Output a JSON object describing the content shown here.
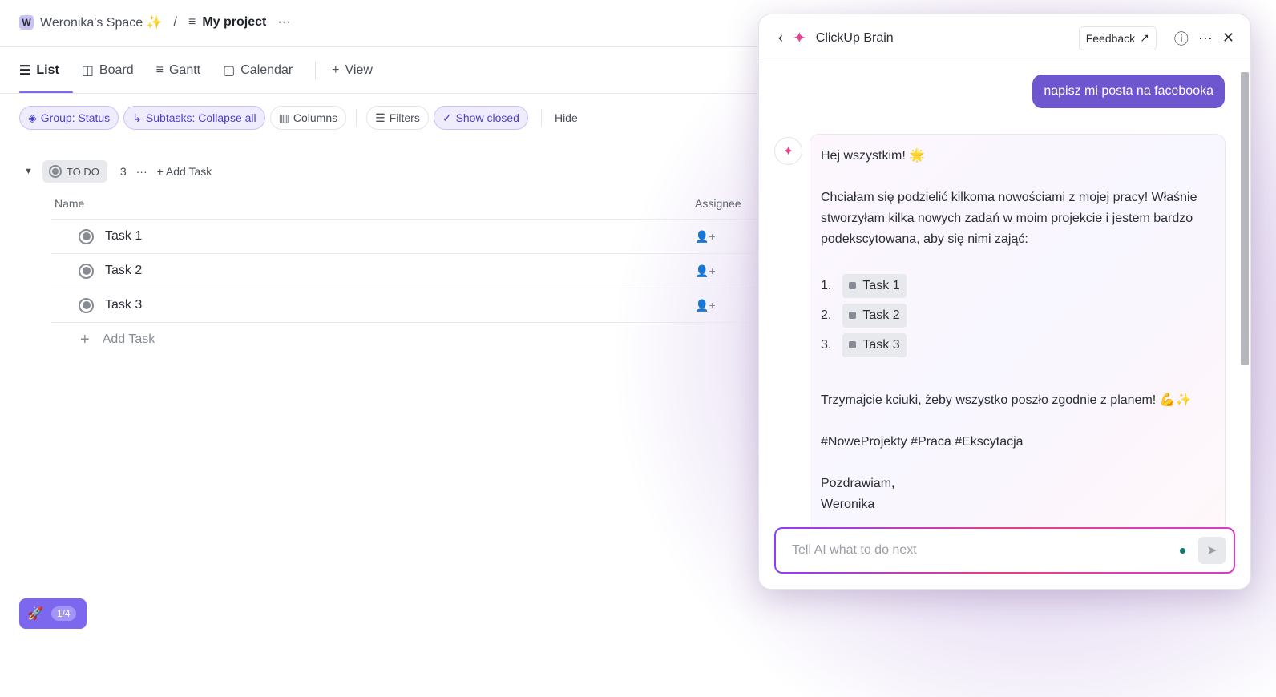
{
  "breadcrumb": {
    "space_initial": "W",
    "space": "Weronika's Space ✨",
    "separator": "/",
    "project": "My project"
  },
  "tabs": [
    {
      "label": "List",
      "icon": "list-icon"
    },
    {
      "label": "Board",
      "icon": "board-icon"
    },
    {
      "label": "Gantt",
      "icon": "gantt-icon"
    },
    {
      "label": "Calendar",
      "icon": "calendar-icon"
    },
    {
      "label": "View",
      "icon": "plus-icon"
    }
  ],
  "toolbar": {
    "group": "Group: Status",
    "subtasks": "Subtasks: Collapse all",
    "columns": "Columns",
    "filters": "Filters",
    "show_closed": "Show closed",
    "hide": "Hide"
  },
  "group": {
    "status": "TO DO",
    "count": "3",
    "add_task": "Add Task"
  },
  "columns": {
    "name": "Name",
    "assignee": "Assignee"
  },
  "tasks": [
    "Task 1",
    "Task 2",
    "Task 3"
  ],
  "add_task": "Add Task",
  "panel": {
    "title": "ClickUp Brain",
    "feedback": "Feedback",
    "user_message": "napisz mi posta na facebooka",
    "reply": {
      "greeting": "Hej wszystkim! 🌟",
      "intro": "Chciałam się podzielić kilkoma nowościami z mojej pracy! Właśnie stworzyłam kilka nowych zadań w moim projekcie i jestem bardzo podekscytowana, aby się nimi zająć:",
      "items": [
        {
          "num": "1.",
          "task": "Task 1"
        },
        {
          "num": "2.",
          "task": "Task 2"
        },
        {
          "num": "3.",
          "task": "Task 3"
        }
      ],
      "outro": "Trzymajcie kciuki, żeby wszystko poszło zgodnie z planem! 💪✨",
      "tags": "#NoweProjekty #Praca #Ekscytacja",
      "signoff": "Pozdrawiam,",
      "name": "Weronika"
    },
    "input_placeholder": "Tell AI what to do next"
  },
  "onboarding": {
    "progress": "1/4"
  },
  "colors": {
    "accent": "#7b68ee",
    "user_bubble": "#6e56cf"
  }
}
